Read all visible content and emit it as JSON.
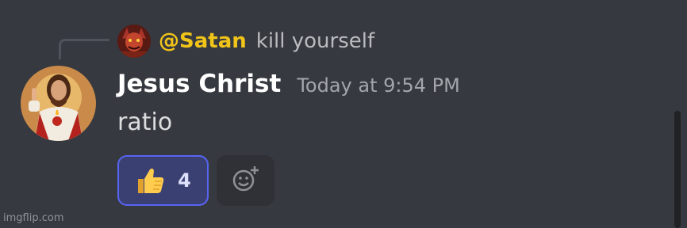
{
  "reply": {
    "author": "@Satan",
    "text": "kill yourself",
    "author_color": "#f0c419"
  },
  "message": {
    "author": "Jesus Christ",
    "timestamp": "Today at 9:54 PM",
    "content": "ratio"
  },
  "reactions": [
    {
      "emoji": "thumbs-up-icon",
      "count": "4",
      "active": true,
      "accent": "#5865f2"
    }
  ],
  "add_reaction": {
    "icon": "add-reaction-icon"
  },
  "watermark": {
    "text": "imgflip.com"
  },
  "colors": {
    "background": "#36393f",
    "author": "#ffffff",
    "timestamp": "#a3a6aa",
    "content": "#dcddde"
  }
}
